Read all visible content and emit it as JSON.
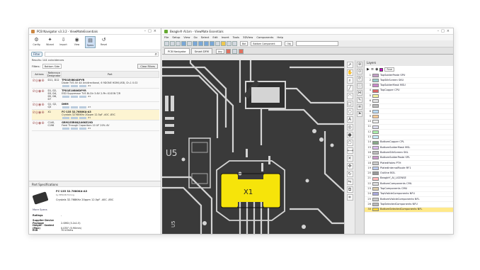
{
  "left_app": {
    "title": "PCB Navigator v3.3.2 - ViewMateEssentials",
    "ribbon": [
      {
        "label": "Config",
        "icon": "gear-icon"
      },
      {
        "label": "Wizard",
        "icon": "wand-icon"
      },
      {
        "label": "Import",
        "icon": "import-icon"
      },
      {
        "label": "View",
        "icon": "eye-icon"
      },
      {
        "label": "Specs",
        "icon": "doc-icon"
      },
      {
        "label": "Reset",
        "icon": "reset-icon"
      }
    ],
    "filter_chip": "Filter",
    "results_text": "Results: 144 coincidences",
    "filters_label": "Filters:",
    "filters_value": "Bottom Side",
    "clear_filters": "Clear Filters",
    "columns": [
      "Actions",
      "Reference Designator",
      "Part"
    ],
    "rows": [
      {
        "ref": "D11, D12",
        "part": "TPD1E0B04DPYR",
        "desc": "Diode TVS 4V 4A Unidirectional, 6 9DONE HDMI,USB, Ch-1 0.02",
        "tag": "#2"
      },
      {
        "ref": "D1, D2, D3, D4, D5, D6, D7",
        "part": "TPD1E10B06DPYR",
        "desc": "ESD Suppressor TVS Bi-Dir 3.6V 2-Pin X1SON T/R",
        "tag": "#2"
      },
      {
        "ref": "Q1, Q2, Q3",
        "part": "DMM",
        "desc": "",
        "tag": "#3"
      },
      {
        "ref": "X1",
        "part": "FC-135 32.7680KA-A3",
        "desc": "Crystals 32768KHz 20ppm 12.5pF -40C -85C",
        "tag": "#1"
      },
      {
        "ref": "C140, C196",
        "part": "GRM155R60J106KE19D",
        "desc": "Feed Through Capacitors 10 UF 20% 4V",
        "tag": "#2"
      }
    ],
    "specs_header": "Part Specifications",
    "spec_part": "FC-135 32.7680KA-A3",
    "spec_mfr": "by EPSON Timing",
    "spec_desc": "Crystals 32.768KHz 20ppm 12.5pF -40C -85C",
    "more_specs": "More Specs",
    "specs": [
      {
        "k": "Ratings",
        "v": "-"
      },
      {
        "k": "Supplier Device Package",
        "v": "2-SMD (3.2x1.5)"
      },
      {
        "k": "Height - Seated (Max)",
        "v": "0.035\" (0.90mm)"
      },
      {
        "k": "ESR",
        "v": "70 kOhms"
      }
    ]
  },
  "right_app": {
    "title": "Beagle® AI.brn - ViewMate Essentials",
    "menu": [
      "File",
      "Setup",
      "View",
      "Go",
      "Select",
      "Edit",
      "Insert",
      "Tools",
      "3DView",
      "Components",
      "Help"
    ],
    "drop1": "Bot",
    "drop2": "Bottom Component",
    "drop3": "Obj",
    "drop4": "Any",
    "tabs": [
      "PCB Navigator",
      "Smart DFM"
    ],
    "canvas": {
      "label_x1": "X1",
      "label_u5": "U5"
    },
    "layers_header": "Layers",
    "layers_btn": "Fuse",
    "layers": [
      {
        "n": "1",
        "name": "TopSolderPaste SPU",
        "c": "#c4a0c8"
      },
      {
        "n": "2",
        "name": "TopSilkScreen SKU",
        "c": "#9cc"
      },
      {
        "n": "3",
        "name": "TopSolderMask MSU",
        "c": "#c8c"
      },
      {
        "n": "4",
        "name": "TopCopper CPU",
        "c": "#d66"
      },
      {
        "n": "5",
        "name": "",
        "c": "#f3f3a0"
      },
      {
        "n": "6",
        "name": "",
        "c": "#e3e3e3"
      },
      {
        "n": "7",
        "name": "",
        "c": "#bbb"
      },
      {
        "n": "8",
        "name": "",
        "c": "#bdf"
      },
      {
        "n": "9",
        "name": "",
        "c": "#fc9"
      },
      {
        "n": "10",
        "name": "",
        "c": "#eee"
      },
      {
        "n": "11",
        "name": "",
        "c": "#dde"
      },
      {
        "n": "12",
        "name": "",
        "c": "#aea"
      },
      {
        "n": "13",
        "name": "",
        "c": "#cef"
      },
      {
        "n": "14",
        "name": "BottomCopper CPL",
        "c": "#8a8"
      },
      {
        "n": "15",
        "name": "BottomSolderMask MSL",
        "c": "#dbe"
      },
      {
        "n": "16",
        "name": "BottomSilkScreen SKL",
        "c": "#bbb"
      },
      {
        "n": "17",
        "name": "BottomSolderPaste SPL",
        "c": "#c9c"
      },
      {
        "n": "18",
        "name": "PlatedHoles PTH",
        "c": "#ccc"
      },
      {
        "n": "19",
        "name": "PlatedInternalRoute RF1",
        "c": "#bce"
      },
      {
        "n": "20",
        "name": "Outline BOL",
        "c": "#999"
      },
      {
        "n": "21",
        "name": "BeagleY_AI_LICENSE",
        "c": "#fbb"
      },
      {
        "n": "22",
        "name": "BottomComponents CML",
        "c": "#ddd"
      },
      {
        "n": "23",
        "name": "TopComponents CMU",
        "c": "#dca"
      },
      {
        "n": "24",
        "name": "TopVisibleComponents NFU",
        "c": "#aad"
      },
      {
        "n": "25",
        "name": "BottomVisibleComponents NFL",
        "c": "#ccc"
      },
      {
        "n": "26",
        "name": "TopSelectedComponents NFU",
        "c": "#bbb"
      },
      {
        "n": "30",
        "name": "BottomSelectedComponents NFL",
        "c": "#f6d43a"
      }
    ]
  },
  "colors": {
    "canvas_bg": "#3a3a3a",
    "trace": "#d9d9d9",
    "pad": "#f6e40a",
    "highlight": "#fdf4d2"
  }
}
